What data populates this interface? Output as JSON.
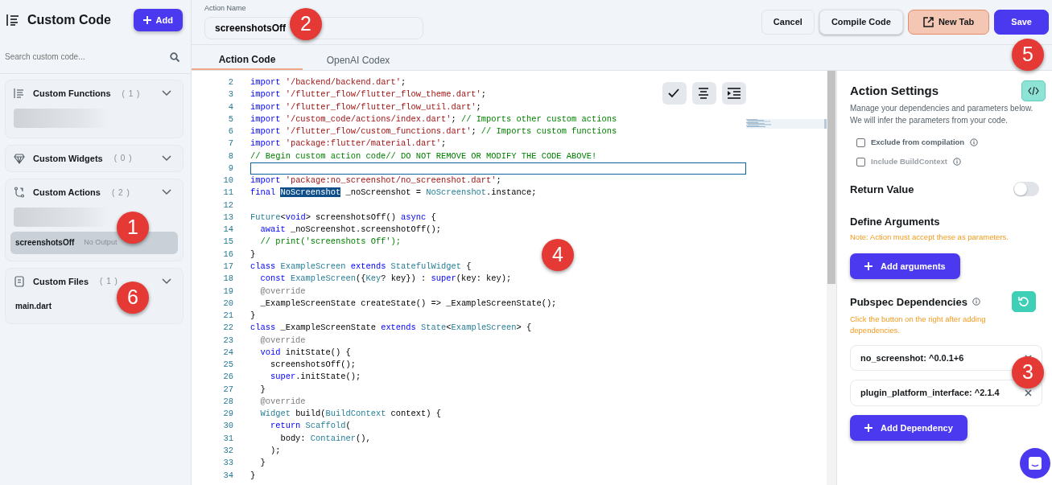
{
  "sidebar": {
    "title": "Custom Code",
    "add_button": "Add",
    "search": {
      "placeholder": "Search custom code..."
    },
    "sections": [
      {
        "title": "Custom Functions",
        "count": "( 1 )",
        "items": [
          {
            "kind": "blurred"
          }
        ]
      },
      {
        "title": "Custom Widgets",
        "count": "( 0 )"
      },
      {
        "title": "Custom Actions",
        "count": "( 2 )",
        "items": [
          {
            "kind": "blurred"
          },
          {
            "kind": "entry",
            "name": "screenshotsOff",
            "note": "No Output",
            "selected": true
          }
        ]
      },
      {
        "title": "Custom Files",
        "count": "( 1 )",
        "items": [
          {
            "kind": "entry",
            "name": "main.dart",
            "selected": false
          }
        ]
      }
    ]
  },
  "header": {
    "field_label": "Action Name",
    "action_name": "screenshotsOff",
    "buttons": [
      {
        "kind": "plain",
        "label": "Cancel"
      },
      {
        "kind": "raised",
        "label": "Compile Code"
      },
      {
        "kind": "newtab",
        "label": "New Tab"
      },
      {
        "kind": "primary",
        "label": "Save"
      }
    ]
  },
  "tabs": [
    {
      "label": "Action Code",
      "selected": true
    },
    {
      "label": "OpenAI Codex",
      "selected": false
    }
  ],
  "editor": {
    "lines": [
      {
        "n": "2",
        "tokens": [
          {
            "kind": "k",
            "text": "import "
          },
          {
            "kind": "s",
            "text": "'/backend/backend.dart'"
          },
          {
            "kind": "p",
            "text": ";"
          }
        ]
      },
      {
        "n": "3",
        "tokens": [
          {
            "kind": "k",
            "text": "import "
          },
          {
            "kind": "s",
            "text": "'/flutter_flow/flutter_flow_theme.dart'"
          },
          {
            "kind": "p",
            "text": ";"
          }
        ]
      },
      {
        "n": "4",
        "tokens": [
          {
            "kind": "k",
            "text": "import "
          },
          {
            "kind": "s",
            "text": "'/flutter_flow/flutter_flow_util.dart'"
          },
          {
            "kind": "p",
            "text": ";"
          }
        ]
      },
      {
        "n": "5",
        "tokens": [
          {
            "kind": "k",
            "text": "import "
          },
          {
            "kind": "s",
            "text": "'/custom_code/actions/index.dart'"
          },
          {
            "kind": "p",
            "text": "; "
          },
          {
            "kind": "c",
            "text": "// Imports other custom actions"
          }
        ]
      },
      {
        "n": "6",
        "tokens": [
          {
            "kind": "k",
            "text": "import "
          },
          {
            "kind": "s",
            "text": "'/flutter_flow/custom_functions.dart'"
          },
          {
            "kind": "p",
            "text": "; "
          },
          {
            "kind": "c",
            "text": "// Imports custom functions"
          }
        ]
      },
      {
        "n": "7",
        "tokens": [
          {
            "kind": "k",
            "text": "import "
          },
          {
            "kind": "s",
            "text": "'package:flutter/material.dart'"
          },
          {
            "kind": "p",
            "text": ";"
          }
        ]
      },
      {
        "n": "8",
        "tokens": [
          {
            "kind": "c",
            "text": "// Begin custom action code// DO NOT REMOVE OR MODIFY THE CODE ABOVE!"
          }
        ]
      },
      {
        "n": "9",
        "current": true
      },
      {
        "n": "10",
        "tokens": [
          {
            "kind": "k",
            "text": "import "
          },
          {
            "kind": "s",
            "text": "'package:no_screenshot/no_screenshot.dart'"
          },
          {
            "kind": "p",
            "text": ";"
          }
        ]
      },
      {
        "n": "11",
        "tokens": [
          {
            "kind": "k",
            "text": "final "
          },
          {
            "kind": "h",
            "text": "NoScreenshot"
          },
          {
            "kind": "p",
            "text": " _noScreenshot = "
          },
          {
            "kind": "t",
            "text": "NoScreenshot"
          },
          {
            "kind": "p",
            "text": ".instance;"
          }
        ]
      },
      {
        "n": "12"
      },
      {
        "n": "13",
        "tokens": [
          {
            "kind": "t",
            "text": "Future"
          },
          {
            "kind": "p",
            "text": "<"
          },
          {
            "kind": "k",
            "text": "void"
          },
          {
            "kind": "p",
            "text": "> screenshotsOff() "
          },
          {
            "kind": "k",
            "text": "async"
          },
          {
            "kind": "p",
            "text": " {"
          }
        ]
      },
      {
        "n": "14",
        "tokens": [
          {
            "kind": "k",
            "text": "  await"
          },
          {
            "kind": "p",
            "text": " _noScreenshot.screenshotOff();"
          }
        ]
      },
      {
        "n": "15",
        "tokens": [
          {
            "kind": "c",
            "text": "  // print('screenshots Off');"
          }
        ]
      },
      {
        "n": "16",
        "tokens": [
          {
            "kind": "p",
            "text": "}"
          }
        ]
      },
      {
        "n": "17",
        "tokens": [
          {
            "kind": "k",
            "text": "class "
          },
          {
            "kind": "t",
            "text": "ExampleScreen"
          },
          {
            "kind": "k",
            "text": " extends "
          },
          {
            "kind": "t",
            "text": "StatefulWidget"
          },
          {
            "kind": "p",
            "text": " {"
          }
        ]
      },
      {
        "n": "18",
        "tokens": [
          {
            "kind": "k",
            "text": "  const "
          },
          {
            "kind": "t",
            "text": "ExampleScreen"
          },
          {
            "kind": "p",
            "text": "({"
          },
          {
            "kind": "t",
            "text": "Key"
          },
          {
            "kind": "p",
            "text": "? key}) : "
          },
          {
            "kind": "k",
            "text": "super"
          },
          {
            "kind": "p",
            "text": "(key: key);"
          }
        ]
      },
      {
        "n": "19",
        "tokens": [
          {
            "kind": "a",
            "text": "  @override"
          }
        ]
      },
      {
        "n": "20",
        "tokens": [
          {
            "kind": "p",
            "text": "  _ExampleScreenState createState() => _ExampleScreenState();"
          }
        ]
      },
      {
        "n": "21",
        "tokens": [
          {
            "kind": "p",
            "text": "}"
          }
        ]
      },
      {
        "n": "22",
        "tokens": [
          {
            "kind": "k",
            "text": "class "
          },
          {
            "kind": "p",
            "text": "_ExampleScreenState "
          },
          {
            "kind": "k",
            "text": "extends "
          },
          {
            "kind": "t",
            "text": "State"
          },
          {
            "kind": "p",
            "text": "<"
          },
          {
            "kind": "t",
            "text": "ExampleScreen"
          },
          {
            "kind": "p",
            "text": "> {"
          }
        ]
      },
      {
        "n": "23",
        "tokens": [
          {
            "kind": "a",
            "text": "  @override"
          }
        ]
      },
      {
        "n": "24",
        "tokens": [
          {
            "kind": "k",
            "text": "  void"
          },
          {
            "kind": "p",
            "text": " initState() {"
          }
        ]
      },
      {
        "n": "25",
        "tokens": [
          {
            "kind": "p",
            "text": "    screenshotsOff();"
          }
        ]
      },
      {
        "n": "26",
        "tokens": [
          {
            "kind": "k",
            "text": "    super"
          },
          {
            "kind": "p",
            "text": ".initState();"
          }
        ]
      },
      {
        "n": "27",
        "tokens": [
          {
            "kind": "p",
            "text": "  }"
          }
        ]
      },
      {
        "n": "28",
        "tokens": [
          {
            "kind": "a",
            "text": "  @override"
          }
        ]
      },
      {
        "n": "29",
        "tokens": [
          {
            "kind": "t",
            "text": "  Widget"
          },
          {
            "kind": "p",
            "text": " build("
          },
          {
            "kind": "t",
            "text": "BuildContext"
          },
          {
            "kind": "p",
            "text": " context) {"
          }
        ]
      },
      {
        "n": "30",
        "tokens": [
          {
            "kind": "k",
            "text": "    return "
          },
          {
            "kind": "t",
            "text": "Scaffold"
          },
          {
            "kind": "p",
            "text": "("
          }
        ]
      },
      {
        "n": "31",
        "tokens": [
          {
            "kind": "p",
            "text": "      body: "
          },
          {
            "kind": "t",
            "text": "Container"
          },
          {
            "kind": "p",
            "text": "(),"
          }
        ]
      },
      {
        "n": "32",
        "tokens": [
          {
            "kind": "p",
            "text": "    );"
          }
        ]
      },
      {
        "n": "33",
        "tokens": [
          {
            "kind": "p",
            "text": "  }"
          }
        ]
      },
      {
        "n": "34",
        "tokens": [
          {
            "kind": "p",
            "text": "}"
          }
        ]
      }
    ]
  },
  "settings": {
    "title": "Action Settings",
    "description": "Manage your dependencies and parameters below. We will infer the parameters from your code.",
    "options": [
      {
        "label": "Exclude from compilation",
        "checked": false,
        "disabled": false
      },
      {
        "label": "Include BuildContext",
        "checked": false,
        "disabled": true
      }
    ],
    "return_value": {
      "label": "Return Value",
      "on": false
    },
    "arguments": {
      "title": "Define Arguments",
      "note": "Note: Action must accept these as parameters.",
      "button": "Add arguments"
    },
    "dependencies": {
      "title": "Pubspec Dependencies",
      "note": "Click the button on the right after adding dependencies.",
      "items": [
        "no_screenshot: ^0.0.1+6",
        "plugin_platform_interface: ^2.1.4"
      ],
      "button": "Add Dependency"
    }
  },
  "callouts": [
    {
      "label": "1"
    },
    {
      "label": "2"
    },
    {
      "label": "3"
    },
    {
      "label": "4"
    },
    {
      "label": "5"
    },
    {
      "label": "6"
    }
  ]
}
